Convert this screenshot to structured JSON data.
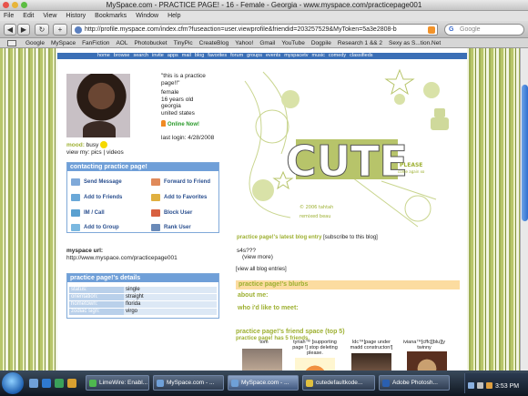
{
  "window": {
    "title": "MySpace.com - PRACTICE PAGE! - 16 - Female - Georgia - www.myspace.com/practicepage001"
  },
  "menubar": [
    "File",
    "Edit",
    "View",
    "History",
    "Bookmarks",
    "Window",
    "Help"
  ],
  "navbar": {
    "back": "◀",
    "forward": "▶",
    "reload": "↻",
    "add": "+",
    "url": "http://profile.myspace.com/index.cfm?fuseaction=user.viewprofile&friendid=203257529&MyToken=5a3e2808-b",
    "search_label": "Google"
  },
  "bookmarks": [
    "Google",
    "MySpace",
    "FanFiction",
    "AOL",
    "Photobucket",
    "TinyPic",
    "CreateBlog",
    "Yahoo!",
    "Gmail",
    "YouTube",
    "Dogpile",
    "Research 1 && 2",
    "Sexy as S...tion.Net"
  ],
  "topnav": [
    "home",
    "browse",
    "search",
    "invite",
    "apps",
    "mail",
    "blog",
    "favorites",
    "forum",
    "groups",
    "events",
    "myspacetv",
    "music",
    "comedy",
    "classifieds"
  ],
  "profile": {
    "quote": "\"this is a practice page!!\"",
    "info": [
      "female",
      "16 years old",
      "georgia",
      "united states"
    ],
    "online": "Online Now!",
    "last_login": "last login: 4/28/2008",
    "mood_label": "mood:",
    "mood_value": "busy",
    "view_my": "view my: pics | videos"
  },
  "contact": {
    "title": "contacting practice page!",
    "items": [
      "Send Message",
      "Forward to Friend",
      "Add to Friends",
      "Add to Favorites",
      "IM / Call",
      "Block User",
      "Add to Group",
      "Rank User"
    ]
  },
  "myspace_url": {
    "label": "myspace url:",
    "value": "http://www.myspace.com/practicepage001"
  },
  "details": {
    "title": "practice page!'s details",
    "rows": [
      {
        "label": "status:",
        "value": "single"
      },
      {
        "label": "orientation:",
        "value": "straight"
      },
      {
        "label": "hometown:",
        "value": "florida"
      },
      {
        "label": "zodiac sign:",
        "value": "virgo"
      }
    ]
  },
  "banner": {
    "word": "CUTE",
    "credit1": "© 2006 tahtah",
    "credit2": "remixed beau",
    "tag": "PLEASE",
    "tag_sub": "come again xo"
  },
  "blog": {
    "entry_label": "practice page!'s latest blog entry",
    "subscribe": "[subscribe to this blog]",
    "entry": "s4s???",
    "view_more": "(view more)",
    "all_entries": "[view all blog entries]"
  },
  "blurbs": {
    "title": "practice page!'s blurbs",
    "about": "about me:",
    "like_to_meet": "who i'd like to meet:"
  },
  "friends": {
    "title": "practice page!'s friend space (top 5)",
    "count_label": "practice page! has 5 friends.",
    "list": [
      {
        "name": "tom"
      },
      {
        "name": "tyriah™ [supporting page !] stop deleting please."
      },
      {
        "name": "ldc™[page under madd constructon!]"
      },
      {
        "name": "iviana™[cffc][blu][y twinny"
      }
    ]
  },
  "taskbar": {
    "buttons": [
      "LimeWire: Enabl...",
      "MySpace.com - ...",
      "MySpace.com - ...",
      "cutedefaultkode...",
      "Adobe Photosh..."
    ],
    "clock": "3:53 PM"
  },
  "colors": {
    "accent_green": "#9db031",
    "myspace_blue": "#6f9fd8",
    "blurb_bar": "#fcdca0"
  }
}
